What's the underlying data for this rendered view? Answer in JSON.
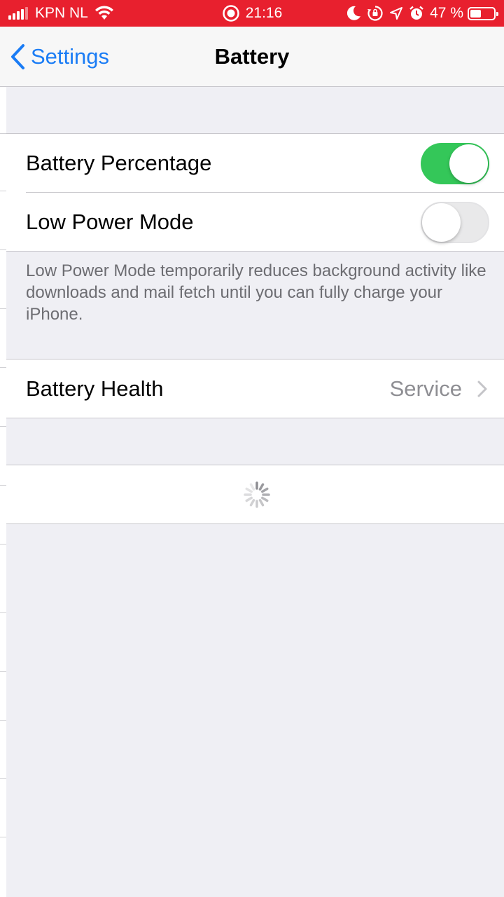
{
  "status_bar": {
    "carrier": "KPN NL",
    "time": "21:16",
    "battery_percent": "47 %",
    "battery_level": 0.47,
    "background": "#e8202e",
    "icons": [
      "signal-icon",
      "wifi-icon",
      "screen-recording-icon",
      "moon-icon",
      "lock-rotation-icon",
      "location-icon",
      "alarm-icon",
      "battery-icon"
    ]
  },
  "nav": {
    "back_label": "Settings",
    "title": "Battery",
    "accent": "#1a7cf5"
  },
  "settings": {
    "battery_percentage": {
      "label": "Battery Percentage",
      "enabled": true
    },
    "low_power_mode": {
      "label": "Low Power Mode",
      "enabled": false
    },
    "low_power_footnote": "Low Power Mode temporarily reduces background activity like downloads and mail fetch until you can fully charge your iPhone.",
    "battery_health": {
      "label": "Battery Health",
      "value": "Service"
    }
  },
  "colors": {
    "toggle_on": "#34c759",
    "background": "#efeff4"
  }
}
